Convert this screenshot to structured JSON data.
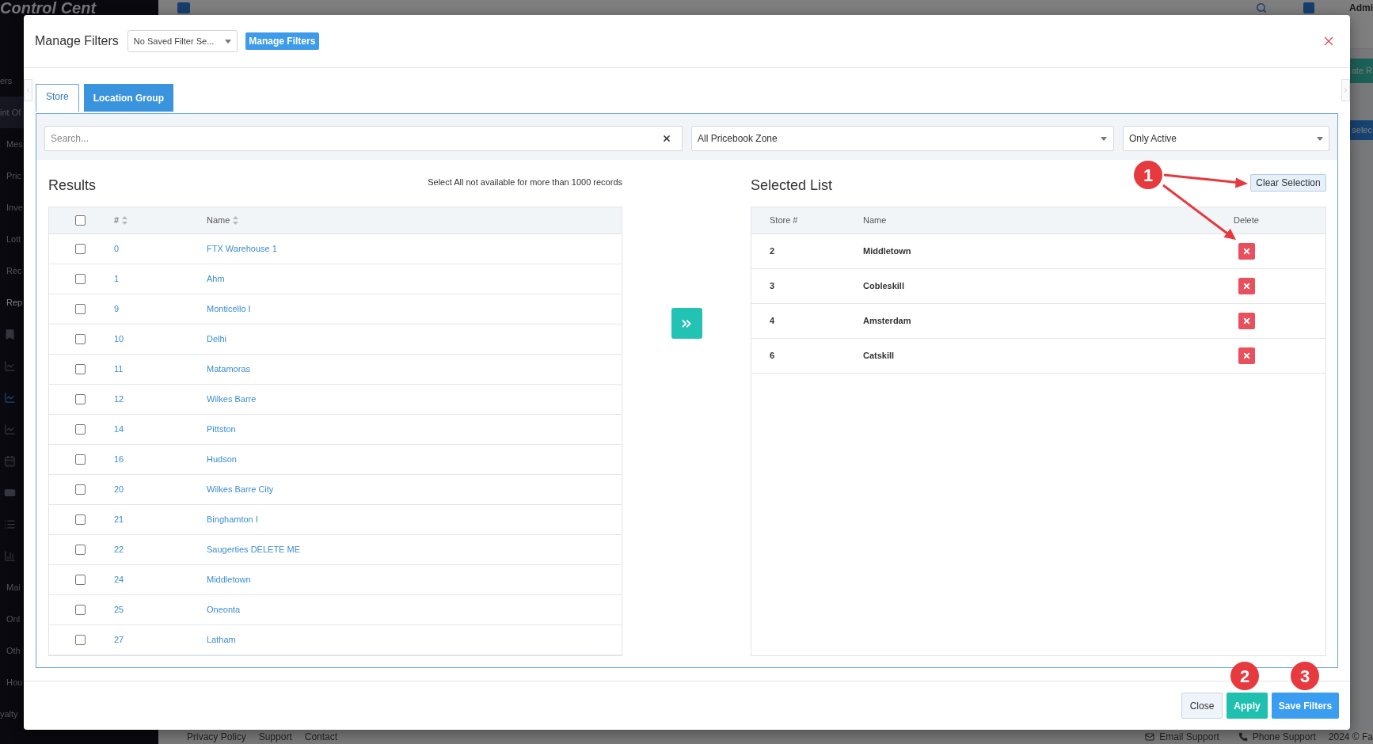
{
  "background": {
    "logo": "Control Cent",
    "sidebar": {
      "items": [
        {
          "kind": "header",
          "label": "ers",
          "expanded": false,
          "selected": false
        },
        {
          "kind": "header",
          "label": "int Of",
          "expanded": true,
          "selected": false
        },
        {
          "kind": "item",
          "label": "Mes",
          "selected": false
        },
        {
          "kind": "item",
          "label": "Pric",
          "selected": false
        },
        {
          "kind": "item",
          "label": "Inve",
          "selected": false
        },
        {
          "kind": "item",
          "label": "Lott",
          "selected": false
        },
        {
          "kind": "item",
          "label": "Rec",
          "selected": false
        },
        {
          "kind": "item",
          "label": "Rep",
          "selected": true
        },
        {
          "kind": "icon",
          "selected": false
        },
        {
          "kind": "icon",
          "selected": false
        },
        {
          "kind": "icon",
          "selected": true
        },
        {
          "kind": "icon",
          "selected": false
        },
        {
          "kind": "icon",
          "selected": false
        },
        {
          "kind": "icon",
          "selected": false
        },
        {
          "kind": "icon",
          "selected": false
        },
        {
          "kind": "icon",
          "selected": false
        },
        {
          "kind": "item",
          "label": "Mai",
          "selected": false
        },
        {
          "kind": "item",
          "label": "Onl",
          "selected": false
        },
        {
          "kind": "item",
          "label": "Oth",
          "selected": false
        },
        {
          "kind": "item",
          "label": "Hou",
          "selected": false
        },
        {
          "kind": "header",
          "label": "yalty",
          "expanded": false,
          "selected": false
        }
      ]
    },
    "header": {
      "user": "Admi"
    },
    "content": {
      "buttons": [
        {
          "label": "ate R",
          "kind": "success"
        },
        {
          "label": "selec",
          "kind": "primary"
        }
      ]
    },
    "footer": {
      "links": [
        "Privacy Policy",
        "Support",
        "Contact"
      ],
      "contacts": [
        {
          "kind": "email",
          "label": "Email Support"
        },
        {
          "kind": "phone",
          "label": "Phone Support"
        }
      ],
      "copyright": "2024 © Fa"
    }
  },
  "modal": {
    "title": "Manage Filters",
    "saved_filter": {
      "value": "No Saved Filter Se..."
    },
    "manage_button": "Manage Filters",
    "tabs": [
      {
        "label": "Store",
        "selected": true
      },
      {
        "label": "Location Group",
        "selected": false
      }
    ],
    "search": {
      "placeholder": "Search..."
    },
    "zone_select": {
      "value": "All Pricebook Zone"
    },
    "status_select": {
      "value": "Only Active"
    },
    "results": {
      "title": "Results",
      "note": "Select All not available for more than 1000 records",
      "select_all": {
        "checked": false
      },
      "columns": [
        {
          "label": "#",
          "sortable": true
        },
        {
          "label": "Name",
          "sortable": true
        }
      ],
      "rows": [
        {
          "number": "0",
          "name": "FTX Warehouse 1",
          "checked": false
        },
        {
          "number": "1",
          "name": "Ahm",
          "checked": false
        },
        {
          "number": "9",
          "name": "Monticello I",
          "checked": false
        },
        {
          "number": "10",
          "name": "Delhi",
          "checked": false
        },
        {
          "number": "11",
          "name": "Matamoras",
          "checked": false
        },
        {
          "number": "12",
          "name": "Wilkes Barre",
          "checked": false
        },
        {
          "number": "14",
          "name": "Pittston",
          "checked": false
        },
        {
          "number": "16",
          "name": "Hudson",
          "checked": false
        },
        {
          "number": "20",
          "name": "Wilkes Barre City",
          "checked": false
        },
        {
          "number": "21",
          "name": "Binghamton I",
          "checked": false
        },
        {
          "number": "22",
          "name": "Saugerties DELETE ME",
          "checked": false
        },
        {
          "number": "24",
          "name": "Middletown",
          "checked": false
        },
        {
          "number": "25",
          "name": "Oneonta",
          "checked": false
        },
        {
          "number": "27",
          "name": "Latham",
          "checked": false
        }
      ]
    },
    "selected_list": {
      "title": "Selected List",
      "clear_button": "Clear Selection",
      "columns": [
        "Store #",
        "Name",
        "Delete"
      ],
      "rows": [
        {
          "number": "2",
          "name": "Middletown"
        },
        {
          "number": "3",
          "name": "Cobleskill"
        },
        {
          "number": "4",
          "name": "Amsterdam"
        },
        {
          "number": "6",
          "name": "Catskill"
        }
      ]
    },
    "footer_buttons": [
      {
        "label": "Close",
        "kind": "secondary"
      },
      {
        "label": "Apply",
        "kind": "success"
      },
      {
        "label": "Save Filters",
        "kind": "primary"
      }
    ]
  },
  "annotations": [
    {
      "label": "1"
    },
    {
      "label": "2"
    },
    {
      "label": "3"
    }
  ]
}
